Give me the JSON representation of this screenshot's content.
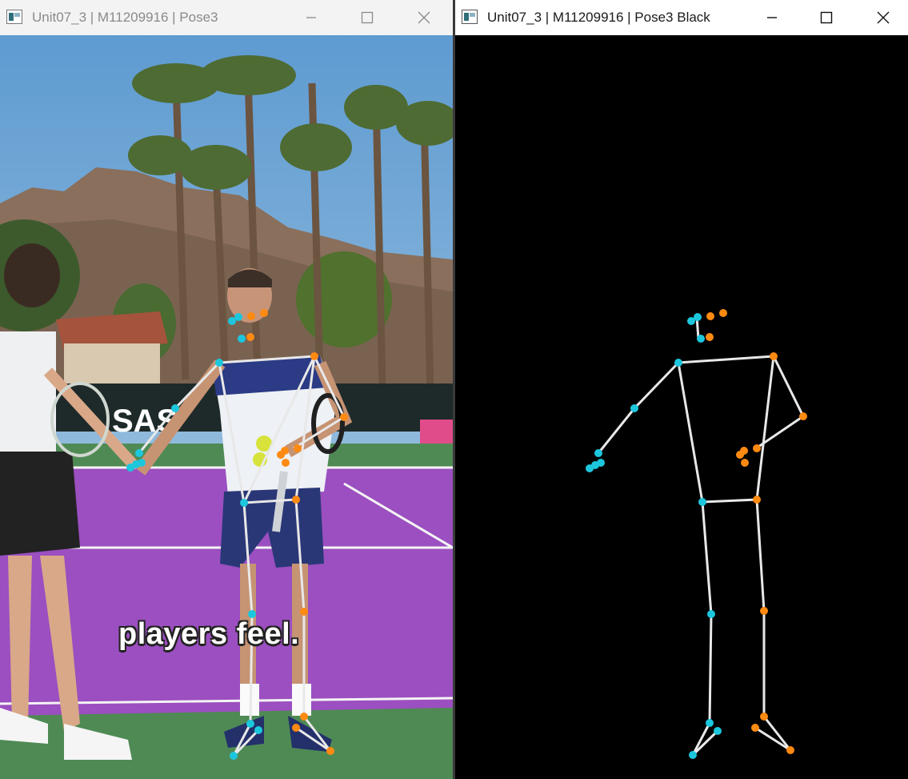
{
  "windows": {
    "left": {
      "title": "Unit07_3 | M11209916 | Pose3"
    },
    "right": {
      "title": "Unit07_3 | M11209916 | Pose3 Black"
    }
  },
  "video": {
    "caption": "players feel.",
    "signage_text": "SAS",
    "court_color": "#9b4fc0",
    "sky_color": "#8fb7d8"
  },
  "icons": {
    "app": "window-app-icon",
    "minimize": "minimize-icon",
    "maximize": "maximize-icon",
    "close": "close-icon"
  },
  "pose_colors": {
    "left_side": "#1cc7dd",
    "right_side": "#ff8a12",
    "bones": "#e8e8e8"
  }
}
